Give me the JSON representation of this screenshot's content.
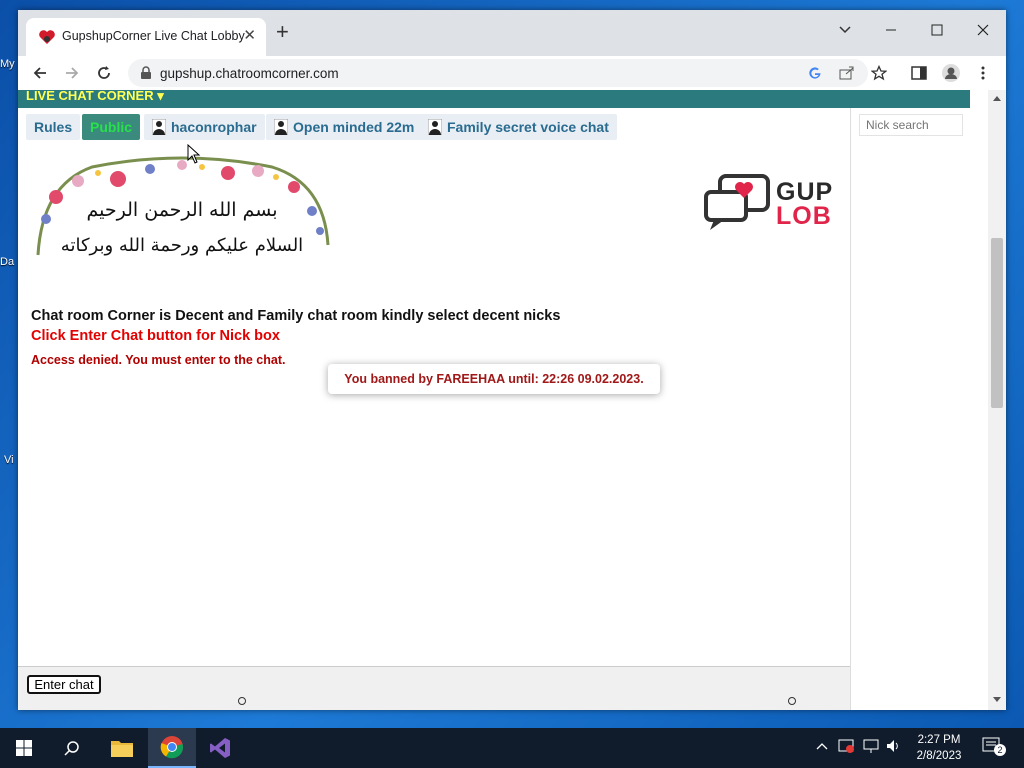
{
  "desktop": {
    "icons": [
      "My",
      "Da",
      "Vi"
    ]
  },
  "browser": {
    "tab_title": "GupshupCorner Live Chat Lobby",
    "tab_close": "✕",
    "new_tab": "+",
    "url": "gupshup.chatroomcorner.com"
  },
  "site": {
    "title": "LIVE CHAT CORNER ▾",
    "tabs": [
      {
        "label": "Rules"
      },
      {
        "label": "Public"
      },
      {
        "label": "haconrophar"
      },
      {
        "label": "Open minded 22m"
      },
      {
        "label": "Family secret voice chat"
      }
    ],
    "logo_text_top": "GUP",
    "logo_text_bottom": "LOB",
    "banner_line1": "بسم الله الرحمن الرحيم",
    "banner_line2": "السلام عليكم ورحمة الله وبركاته",
    "notice_main": "Chat room Corner is Decent and Family chat room kindly select decent nicks",
    "notice_enter": "Click Enter Chat button for Nick box",
    "notice_denied": "Access denied. You must enter to the chat.",
    "toast": "You banned by FAREEHAA until: 22:26 09.02.2023.",
    "nick_search_placeholder": "Nick search",
    "enter_chat": "Enter chat"
  },
  "taskbar": {
    "time": "2:27 PM",
    "date": "2/8/2023",
    "notifications": "2"
  },
  "colors": {
    "teal": "#2b7a7e",
    "title_yellow": "#ffff55",
    "tab_text": "#2a6b90",
    "alert_red": "#e30000"
  }
}
